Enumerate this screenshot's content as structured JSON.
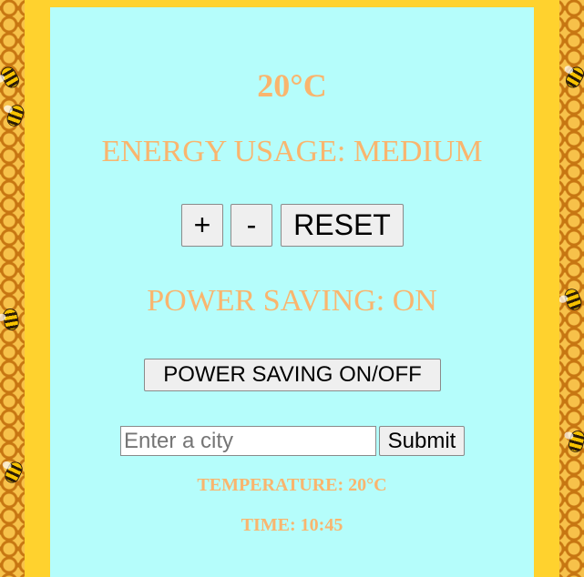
{
  "thermostat": {
    "temperature": "20°C",
    "energy_usage": "ENERGY USAGE: MEDIUM",
    "increase_label": "+",
    "decrease_label": "-",
    "reset_label": "RESET",
    "power_saving_status": "POWER SAVING: ON",
    "power_saving_toggle_label": "POWER SAVING ON/OFF"
  },
  "weather": {
    "city_placeholder": "Enter a city",
    "city_value": "",
    "submit_label": "Submit",
    "temperature": "TEMPERATURE: 20°C",
    "time": "TIME: 10:45"
  },
  "colors": {
    "text_accent": "#f9b56e",
    "panel_background": "#b5fdfb",
    "frame_border": "#ffd22e"
  }
}
